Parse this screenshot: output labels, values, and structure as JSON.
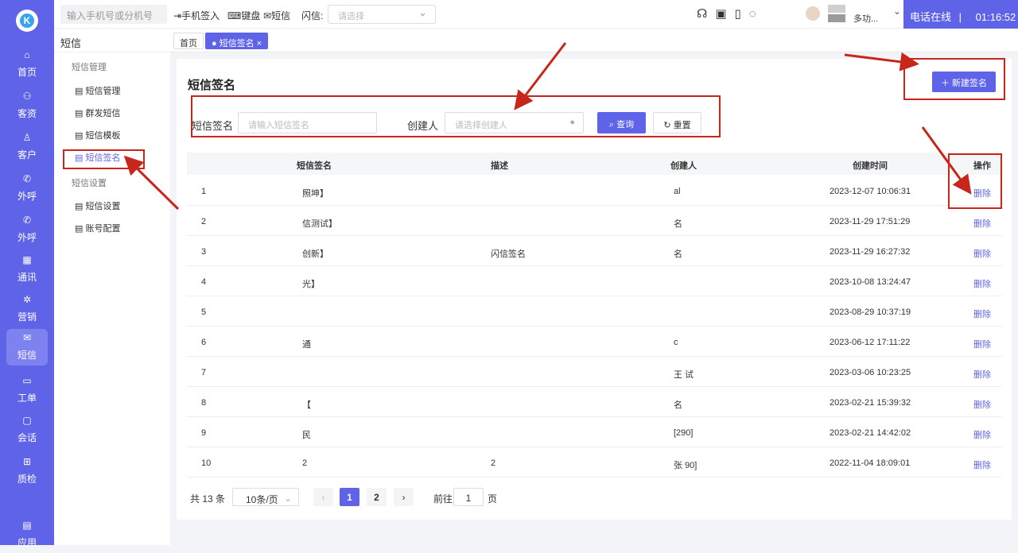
{
  "nav": {
    "items": [
      {
        "label": "首页",
        "icon": "home-icon",
        "active": false
      },
      {
        "label": "客资",
        "icon": "leads-icon",
        "active": false
      },
      {
        "label": "客户",
        "icon": "customer-icon",
        "active": false
      },
      {
        "label": "外呼",
        "icon": "callout-icon",
        "active": false
      },
      {
        "label": "外呼",
        "icon": "callout-icon",
        "active": false
      },
      {
        "label": "通讯",
        "icon": "contacts-icon",
        "active": false
      },
      {
        "label": "营销",
        "icon": "marketing-icon",
        "active": false
      },
      {
        "label": "短信",
        "icon": "sms-icon",
        "active": true
      },
      {
        "label": "工单",
        "icon": "ticket-icon",
        "active": false
      },
      {
        "label": "会话",
        "icon": "chat-icon",
        "active": false
      },
      {
        "label": "质检",
        "icon": "quality-icon",
        "active": false
      },
      {
        "label": "应用",
        "icon": "apps-icon",
        "active": false
      }
    ]
  },
  "topbar": {
    "search_placeholder": "输入手机号或分机号",
    "phone_signin": "手机签入",
    "keyboard": "键盘",
    "sms": "短信",
    "flash_label": "闪信:",
    "flash_select_placeholder": "请选择",
    "user_name": "多功...",
    "status": "电话在线",
    "timer": "01:16:52"
  },
  "submenu": {
    "title": "短信",
    "group1": "短信管理",
    "items1": [
      "短信管理",
      "群发短信",
      "短信模板",
      "短信签名"
    ],
    "group2": "短信设置",
    "items2": [
      "短信设置",
      "账号配置"
    ]
  },
  "tabs": [
    "首页",
    "短信签名"
  ],
  "page": {
    "title": "短信签名",
    "new_button": "＋ 新建签名",
    "filter": {
      "sign_label": "短信签名",
      "sign_placeholder": "请输入短信签名",
      "creator_label": "创建人",
      "creator_placeholder": "请选择创建人",
      "query": "查询",
      "reset": "重置"
    },
    "columns": [
      "短信签名",
      "描述",
      "创建人",
      "创建时间",
      "操作"
    ],
    "rows": [
      {
        "no": "1",
        "sign": "照坤】",
        "desc": "",
        "creator": "al",
        "time": "2023-12-07 10:06:31",
        "action": "删除"
      },
      {
        "no": "2",
        "sign": "信测试】",
        "desc": "",
        "creator": "名",
        "time": "2023-11-29 17:51:29",
        "action": "删除"
      },
      {
        "no": "3",
        "sign": "创新】",
        "desc": "闪信签名",
        "creator": "名",
        "time": "2023-11-29 16:27:32",
        "action": "删除"
      },
      {
        "no": "4",
        "sign": "光】",
        "desc": "",
        "creator": "",
        "time": "2023-10-08 13:24:47",
        "action": "删除"
      },
      {
        "no": "5",
        "sign": "",
        "desc": "",
        "creator": "",
        "time": "2023-08-29 10:37:19",
        "action": "删除"
      },
      {
        "no": "6",
        "sign": "通",
        "desc": "",
        "creator": "c",
        "time": "2023-06-12 17:11:22",
        "action": "删除"
      },
      {
        "no": "7",
        "sign": "",
        "desc": "",
        "creator": "王 试",
        "time": "2023-03-06 10:23:25",
        "action": "删除"
      },
      {
        "no": "8",
        "sign": "【",
        "desc": "",
        "creator": "名",
        "time": "2023-02-21 15:39:32",
        "action": "删除"
      },
      {
        "no": "9",
        "sign": "民",
        "desc": "",
        "creator": "[290]",
        "time": "2023-02-21 14:42:02",
        "action": "删除"
      },
      {
        "no": "10",
        "sign": "2",
        "desc": "2",
        "creator": "张 90]",
        "time": "2022-11-04 18:09:01",
        "action": "删除"
      }
    ],
    "pagination": {
      "total": "共 13 条",
      "page_size": "10条/页",
      "pages": [
        "1",
        "2"
      ],
      "goto_label": "前往",
      "goto_value": "1",
      "goto_suffix": "页"
    }
  },
  "colors": {
    "accent": "#5f63e8",
    "annotation": "#c8261b"
  }
}
